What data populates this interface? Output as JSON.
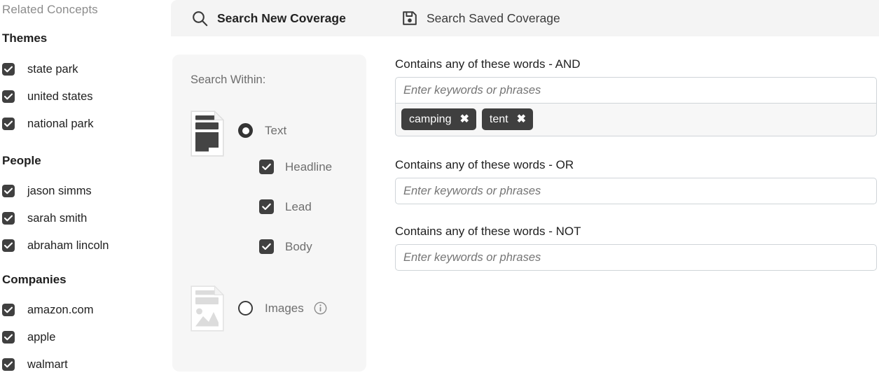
{
  "sidebar": {
    "title": "Related Concepts",
    "groups": [
      {
        "header": "Themes",
        "items": [
          {
            "label": "state park",
            "checked": true
          },
          {
            "label": "united states",
            "checked": true
          },
          {
            "label": "national park",
            "checked": true
          }
        ]
      },
      {
        "header": "People",
        "items": [
          {
            "label": "jason simms",
            "checked": true
          },
          {
            "label": "sarah smith",
            "checked": true
          },
          {
            "label": "abraham lincoln",
            "checked": true
          }
        ]
      },
      {
        "header": "Companies",
        "items": [
          {
            "label": "amazon.com",
            "checked": true
          },
          {
            "label": "apple",
            "checked": true
          },
          {
            "label": "walmart",
            "checked": true
          }
        ]
      }
    ]
  },
  "tabs": [
    {
      "id": "new",
      "label": "Search New Coverage",
      "icon": "search-icon",
      "active": true
    },
    {
      "id": "saved",
      "label": "Search Saved Coverage",
      "icon": "save-icon",
      "active": false
    }
  ],
  "search_within": {
    "title": "Search Within:",
    "options": [
      {
        "id": "text",
        "label": "Text",
        "selected": true,
        "icon": "text-document-icon",
        "sub_options": [
          {
            "label": "Headline",
            "checked": true
          },
          {
            "label": "Lead",
            "checked": true
          },
          {
            "label": "Body",
            "checked": true
          }
        ]
      },
      {
        "id": "images",
        "label": "Images",
        "selected": false,
        "icon": "image-document-icon",
        "info_icon": "info-icon",
        "sub_options": []
      }
    ]
  },
  "query_fields": [
    {
      "id": "and",
      "label": "Contains any of these words - AND",
      "value": "",
      "placeholder": "Enter keywords or phrases",
      "chips": [
        "camping",
        "tent"
      ]
    },
    {
      "id": "or",
      "label": "Contains any of these words - OR",
      "value": "",
      "placeholder": "Enter keywords or phrases",
      "chips": []
    },
    {
      "id": "not",
      "label": "Contains any of these words - NOT",
      "value": "",
      "placeholder": "Enter keywords or phrases",
      "chips": []
    }
  ],
  "colors": {
    "tabbar_bg": "#f4f4f4",
    "panel_bg": "#f6f6f6",
    "control_dark": "#404040",
    "chip_bg": "#3f3f3f",
    "input_border": "#cfd4d8",
    "muted_text": "#6f6f6f",
    "body_text": "#1f1f1f"
  }
}
